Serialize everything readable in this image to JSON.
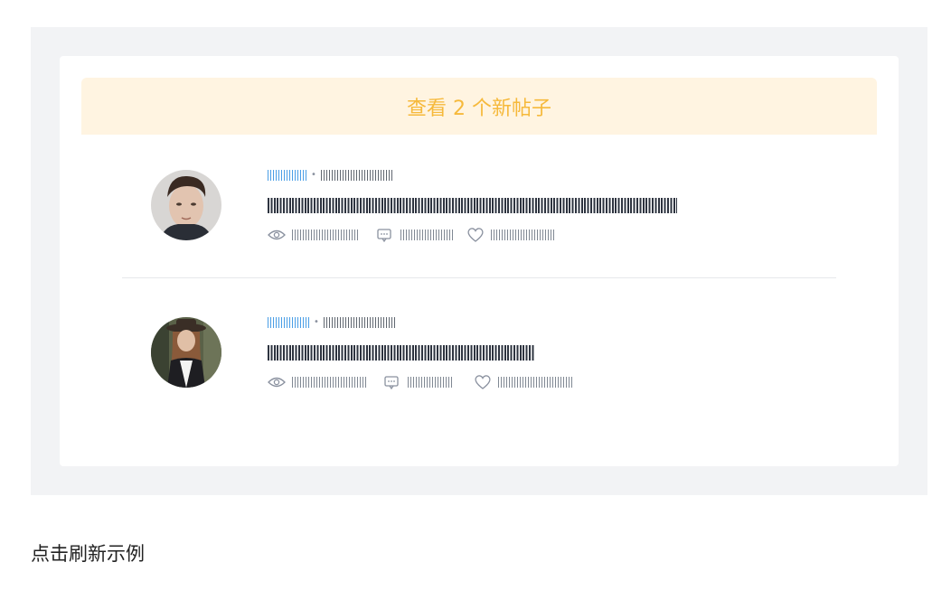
{
  "banner": {
    "label": "查看 2 个新帖子"
  },
  "posts": [
    {
      "avatar": "man-avatar",
      "stats_icons": [
        "eye-icon",
        "comment-icon",
        "heart-icon"
      ]
    },
    {
      "avatar": "woman-avatar",
      "stats_icons": [
        "eye-icon",
        "comment-icon",
        "heart-icon"
      ]
    }
  ],
  "footer": {
    "refresh_label": "点击刷新示例"
  },
  "colors": {
    "accent_banner_text": "#f6b93b",
    "banner_bg": "#fff4e1",
    "author_link": "#4a9ee6",
    "frame_bg": "#f2f3f5"
  }
}
